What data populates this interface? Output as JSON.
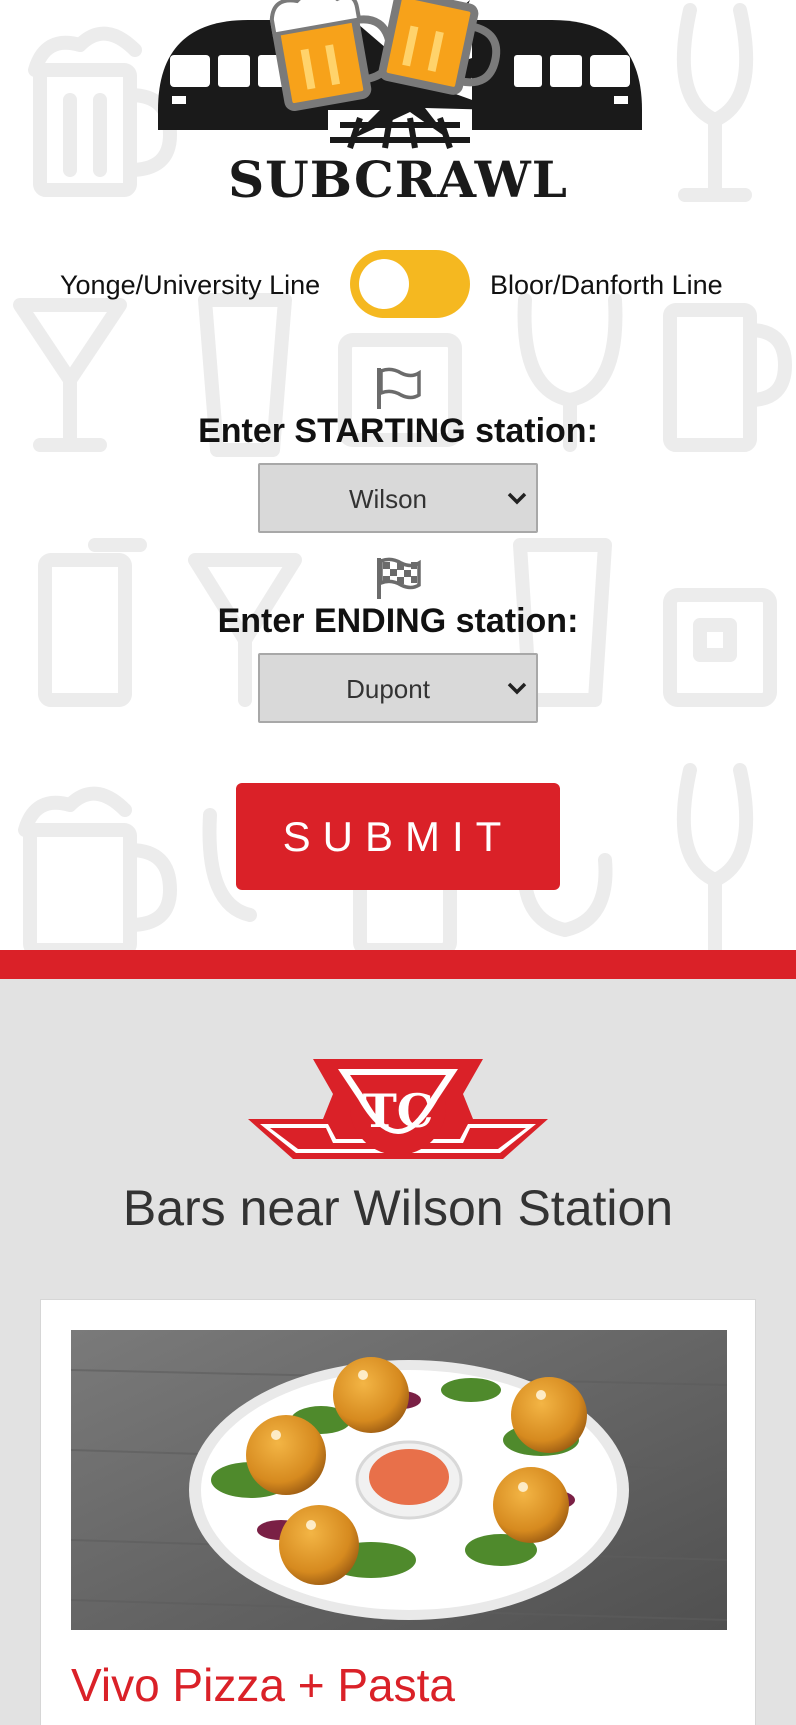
{
  "app": {
    "brand": "SUBCRAWL"
  },
  "line_toggle": {
    "left_label": "Yonge/University Line",
    "right_label": "Bloor/Danforth Line",
    "color": "#f5b820"
  },
  "start": {
    "icon": "flag-outline-icon",
    "label": "Enter STARTING station:",
    "selected": "Wilson"
  },
  "end": {
    "icon": "checkered-flag-icon",
    "label": "Enter ENDING station:",
    "selected": "Dupont"
  },
  "submit": {
    "label": "SUBMIT"
  },
  "colors": {
    "accent_red": "#da2128",
    "toggle_yellow": "#f5b820",
    "section_gray": "#e2e2e2"
  },
  "results": {
    "logo": "ttc-logo",
    "title": "Bars near Wilson Station",
    "cards": [
      {
        "image": "arancini-plate-photo",
        "name": "Vivo Pizza + Pasta"
      }
    ]
  }
}
